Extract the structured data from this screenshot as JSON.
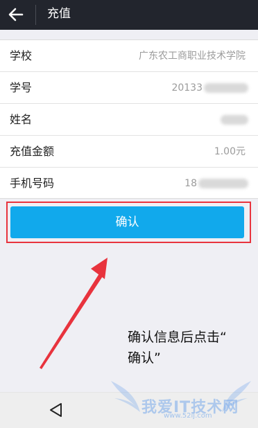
{
  "header": {
    "title": "充值"
  },
  "form": {
    "rows": [
      {
        "label": "学校",
        "value": "广东农工商职业技术学院"
      },
      {
        "label": "学号",
        "value": "20133"
      },
      {
        "label": "姓名",
        "value": ""
      },
      {
        "label": "充值金额",
        "value": "1.00元"
      },
      {
        "label": "手机号码",
        "value": "18"
      }
    ]
  },
  "confirm_label": "确认",
  "annotation": {
    "line1": "确认信息后点击“",
    "line2": "确认”"
  },
  "watermark": {
    "text": "我爱IT技术网",
    "url": "www.52ij.com"
  },
  "colors": {
    "header_bg": "#22252d",
    "button_bg": "#11a9ec",
    "highlight": "#e8333d"
  },
  "icons": {
    "header_back": "back-arrow-icon",
    "nav_back": "triangle-back-icon"
  }
}
